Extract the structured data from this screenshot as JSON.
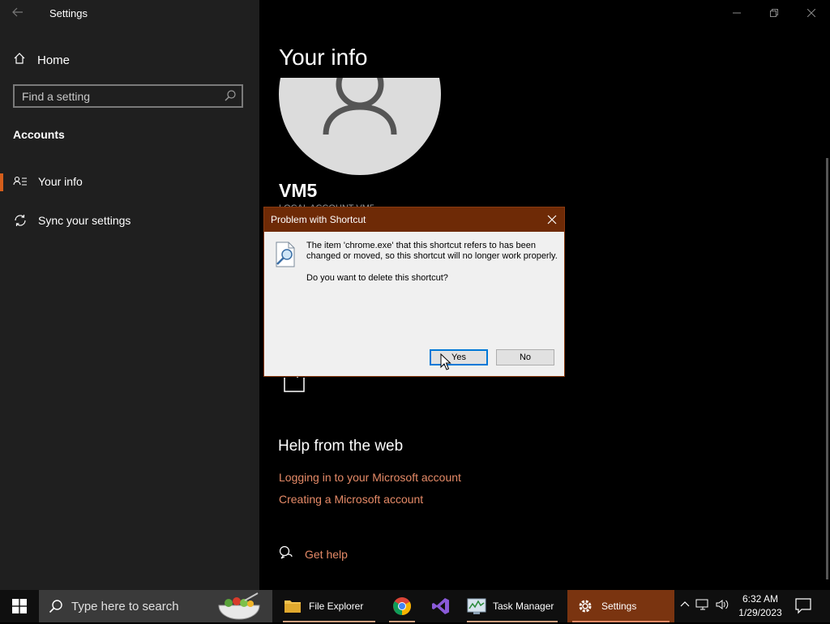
{
  "settings": {
    "app_title": "Settings",
    "nav": {
      "home_label": "Home",
      "search_placeholder": "Find a setting",
      "section_label": "Accounts",
      "items": [
        {
          "label": "Your info",
          "icon": "person-list-icon",
          "active": true
        },
        {
          "label": "Sync your settings",
          "icon": "sync-icon",
          "active": false
        }
      ]
    },
    "main": {
      "page_title": "Your info",
      "user_name": "VM5",
      "user_subtitle": "LOCAL ACCOUNT VM5",
      "help_heading": "Help from the web",
      "help_links": [
        "Logging in to your Microsoft account",
        "Creating a Microsoft account"
      ],
      "get_help_label": "Get help"
    }
  },
  "dialog": {
    "title": "Problem with Shortcut",
    "message": "The item 'chrome.exe' that this shortcut refers to has been changed or moved, so this shortcut will no longer work properly.",
    "question": "Do you want to delete this shortcut?",
    "yes_label": "Yes",
    "no_label": "No"
  },
  "taskbar": {
    "search_placeholder": "Type here to search",
    "apps": [
      {
        "label": "File Explorer",
        "icon": "folder-icon"
      },
      {
        "label": "",
        "icon": "chrome-icon"
      },
      {
        "label": "",
        "icon": "visual-studio-icon"
      },
      {
        "label": "Task Manager",
        "icon": "task-manager-icon"
      },
      {
        "label": "Settings",
        "icon": "gear-icon"
      }
    ],
    "time": "6:32 AM",
    "date": "1/29/2023"
  },
  "colors": {
    "accent": "#e58a67",
    "active_indicator": "#d45e1b",
    "dialog_titlebar": "#6e2a06",
    "taskbar_active": "#7a3410"
  }
}
